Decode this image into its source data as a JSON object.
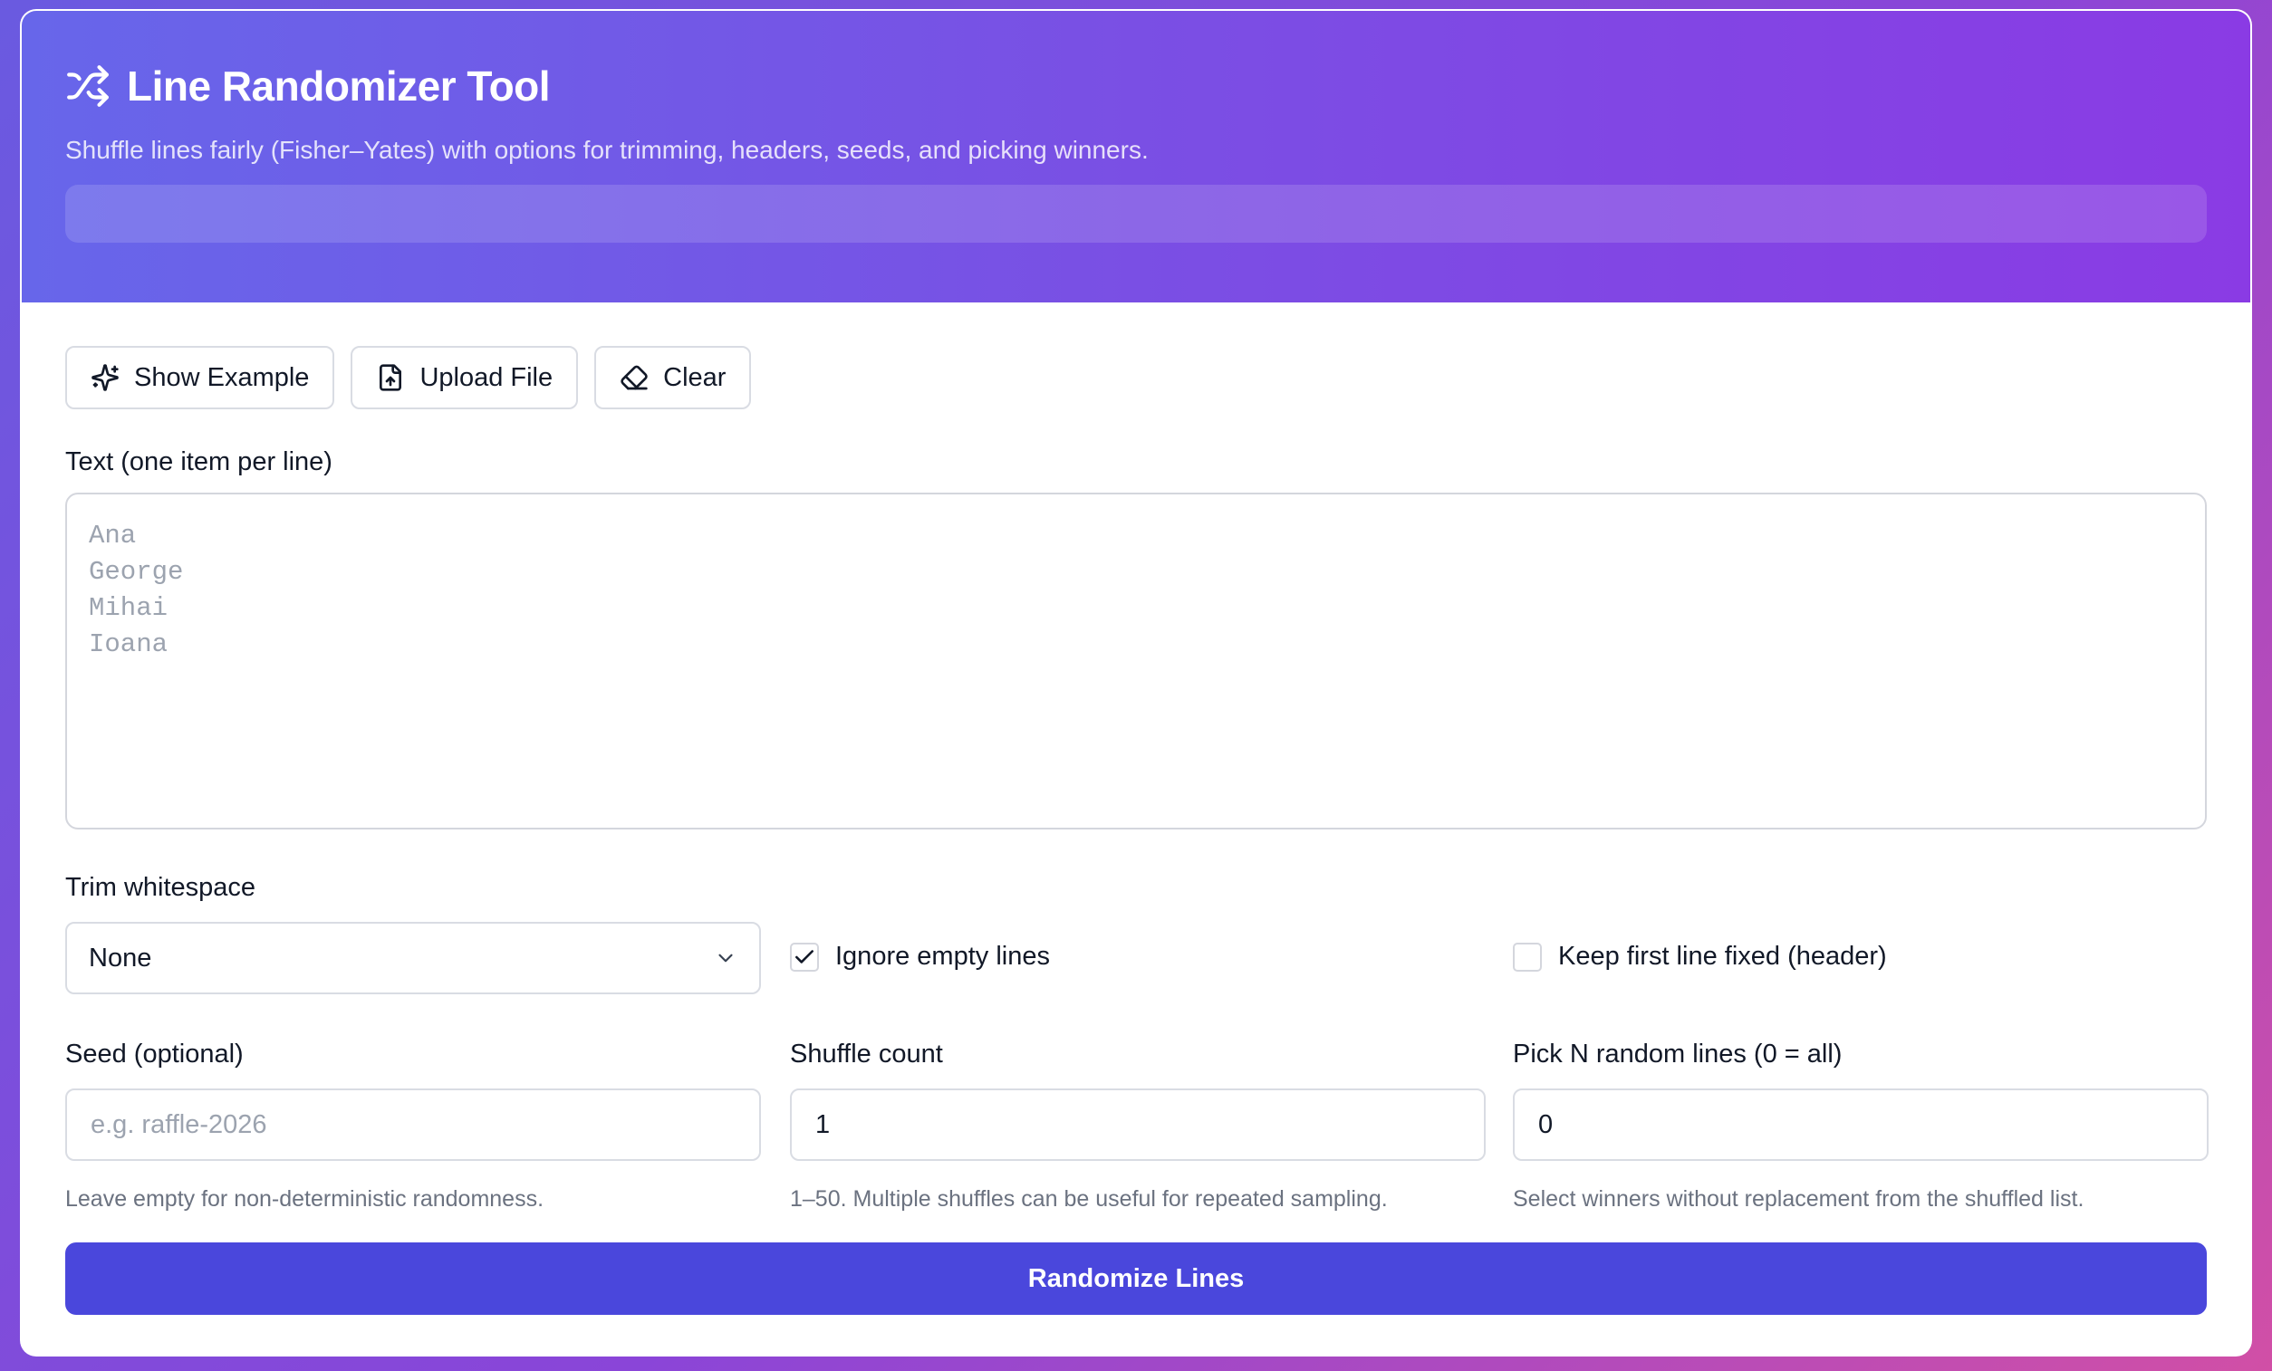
{
  "header": {
    "title": "Line Randomizer Tool",
    "subtitle": "Shuffle lines fairly (Fisher–Yates) with options for trimming, headers, seeds, and picking winners.",
    "icon": "shuffle-icon"
  },
  "toolbar": {
    "example_label": "Show Example",
    "upload_label": "Upload File",
    "clear_label": "Clear"
  },
  "text_input": {
    "label": "Text (one item per line)",
    "placeholder": "Ana\nGeorge\nMihai\nIoana",
    "value": ""
  },
  "trim": {
    "label": "Trim whitespace",
    "selected": "None"
  },
  "options": {
    "ignore_empty": {
      "label": "Ignore empty lines",
      "checked": true
    },
    "keep_header": {
      "label": "Keep first line fixed (header)",
      "checked": false
    }
  },
  "seed": {
    "label": "Seed (optional)",
    "placeholder": "e.g. raffle-2026",
    "value": "",
    "hint": "Leave empty for non-deterministic randomness."
  },
  "shuffle_count": {
    "label": "Shuffle count",
    "value": "1",
    "hint": "1–50. Multiple shuffles can be useful for repeated sampling."
  },
  "pick_n": {
    "label": "Pick N random lines (0 = all)",
    "value": "0",
    "hint": "Select winners without replacement from the shuffled list."
  },
  "action": {
    "label": "Randomize Lines",
    "color": "#4a47dc"
  }
}
